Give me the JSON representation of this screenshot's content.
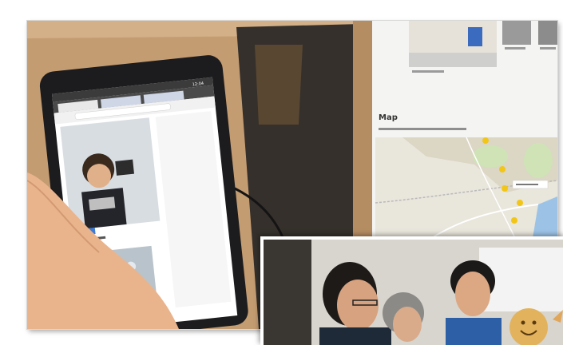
{
  "tablet": {
    "status_time": "12:04",
    "tabs": [
      "",
      ""
    ],
    "url": "",
    "tag_label": ""
  },
  "monitor": {
    "map_heading": "Map",
    "map_subtext": ""
  },
  "colors": {
    "cardboard": "#c9a27a",
    "tablet_body": "#1c1c1e",
    "map_land": "#e9e6dc",
    "map_green": "#cfe3b6",
    "map_water": "#9cc3e6",
    "marker_yellow": "#f2c618",
    "skin": "#e9b48c"
  }
}
